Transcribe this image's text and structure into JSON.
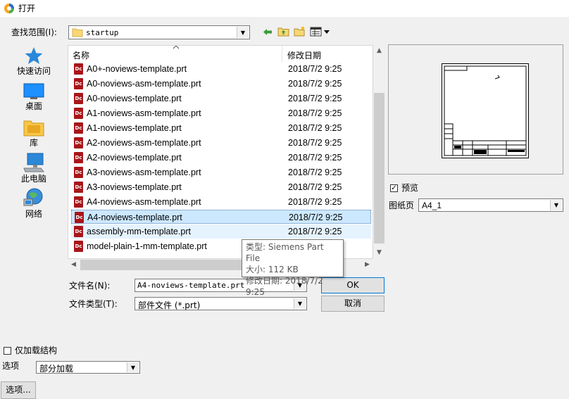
{
  "window": {
    "title": "打开"
  },
  "lookin": {
    "label": "查找范围(I):",
    "value": "startup"
  },
  "places": [
    {
      "label": "快速访问",
      "icon": "star-icon"
    },
    {
      "label": "桌面",
      "icon": "desktop-icon"
    },
    {
      "label": "库",
      "icon": "library-folder-icon"
    },
    {
      "label": "此电脑",
      "icon": "computer-icon"
    },
    {
      "label": "网络",
      "icon": "network-icon"
    }
  ],
  "filelist": {
    "col_name": "名称",
    "col_date": "修改日期",
    "files": [
      {
        "name": "A0+-noviews-template.prt",
        "date": "2018/7/2 9:25"
      },
      {
        "name": "A0-noviews-asm-template.prt",
        "date": "2018/7/2 9:25"
      },
      {
        "name": "A0-noviews-template.prt",
        "date": "2018/7/2 9:25"
      },
      {
        "name": "A1-noviews-asm-template.prt",
        "date": "2018/7/2 9:25"
      },
      {
        "name": "A1-noviews-template.prt",
        "date": "2018/7/2 9:25"
      },
      {
        "name": "A2-noviews-asm-template.prt",
        "date": "2018/7/2 9:25"
      },
      {
        "name": "A2-noviews-template.prt",
        "date": "2018/7/2 9:25"
      },
      {
        "name": "A3-noviews-asm-template.prt",
        "date": "2018/7/2 9:25"
      },
      {
        "name": "A3-noviews-template.prt",
        "date": "2018/7/2 9:25"
      },
      {
        "name": "A4-noviews-asm-template.prt",
        "date": "2018/7/2 9:25"
      },
      {
        "name": "A4-noviews-template.prt",
        "date": "2018/7/2 9:25"
      },
      {
        "name": "assembly-mm-template.prt",
        "date": "2018/7/2 9:25"
      },
      {
        "name": "model-plain-1-mm-template.prt",
        "date": "2018/7/2 9:25"
      }
    ],
    "file_icon_text": "Dc",
    "selected_index": 10,
    "hover_index": 11
  },
  "tooltip": {
    "type": "类型: Siemens Part File",
    "size": "大小: 112 KB",
    "modified": "修改日期: 2018/7/2 9:25"
  },
  "preview": {
    "checkbox_label": "预览",
    "checked": true,
    "sheet_label": "图纸页",
    "sheet_value": "A4_1"
  },
  "filename": {
    "label": "文件名(N):",
    "value": "A4-noviews-template.prt"
  },
  "filetype": {
    "label": "文件类型(T):",
    "value": "部件文件 (*.prt)"
  },
  "buttons": {
    "ok": "OK",
    "cancel": "取消",
    "options": "选项..."
  },
  "partial": {
    "checkbox_label": "仅加载结构",
    "checked": false,
    "options_label": "选项",
    "options_value": "部分加载"
  },
  "colors": {
    "accent": "#0078d7",
    "selected_row": "#cce8ff",
    "hover_row": "#e5f3ff",
    "file_icon": "#a8161a"
  }
}
